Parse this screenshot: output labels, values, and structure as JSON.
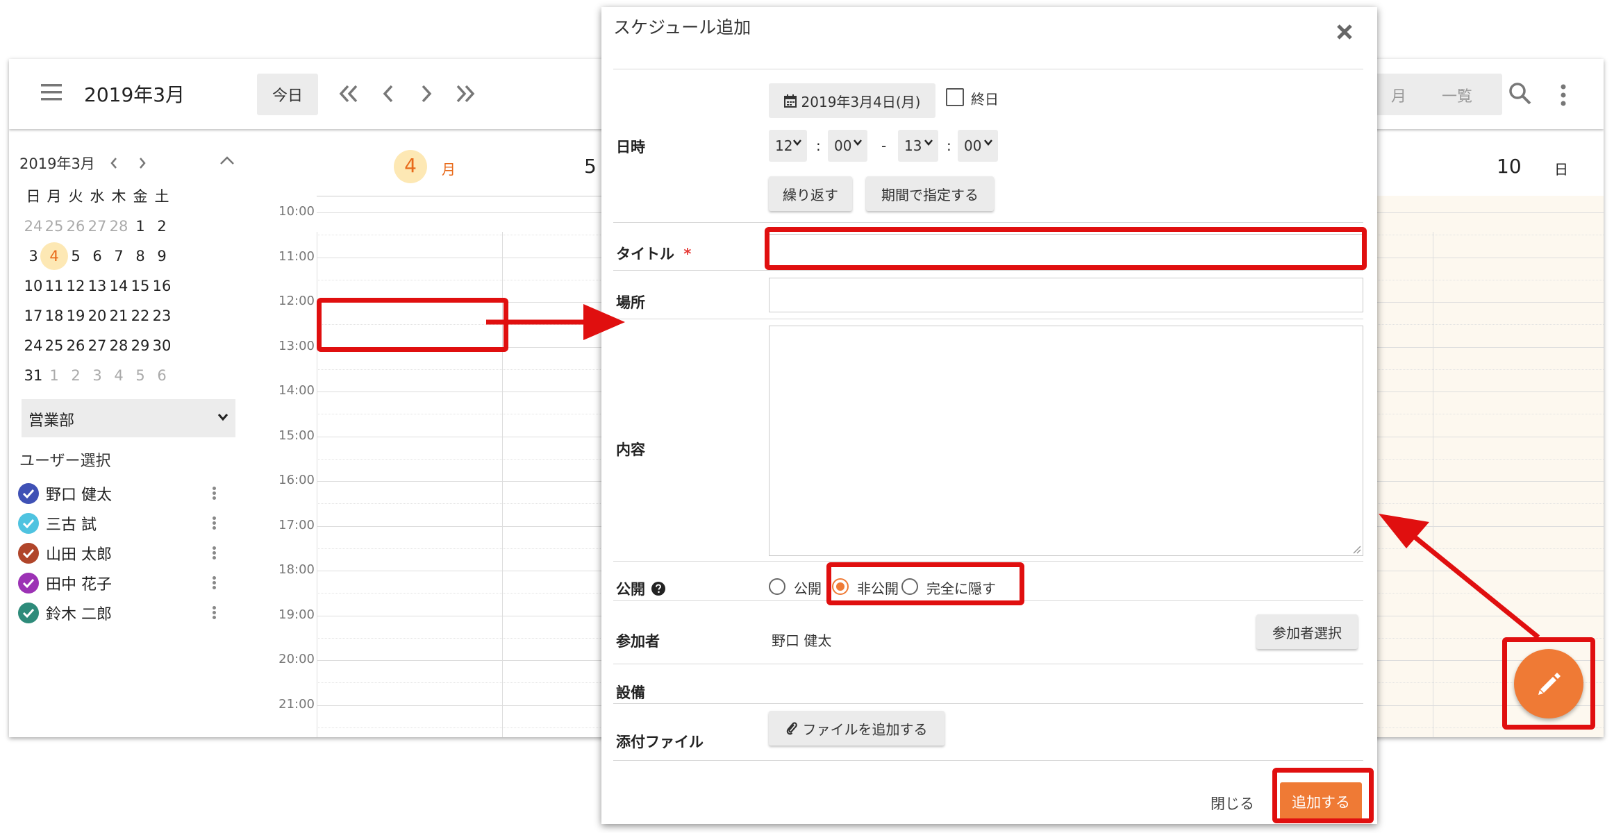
{
  "header": {
    "month_title": "2019年3月",
    "today_button": "今日",
    "view_month": "月",
    "view_list": "一覧"
  },
  "day_headers": {
    "day4_num": "4",
    "day4_weekday": "月",
    "day5_num": "5",
    "day10_num": "10",
    "day10_weekday": "日"
  },
  "mini_calendar": {
    "title": "2019年3月",
    "weekdays": [
      "日",
      "月",
      "火",
      "水",
      "木",
      "金",
      "土"
    ],
    "weeks": [
      [
        "24",
        "25",
        "26",
        "27",
        "28",
        "1",
        "2"
      ],
      [
        "3",
        "4",
        "5",
        "6",
        "7",
        "8",
        "9"
      ],
      [
        "10",
        "11",
        "12",
        "13",
        "14",
        "15",
        "16"
      ],
      [
        "17",
        "18",
        "19",
        "20",
        "21",
        "22",
        "23"
      ],
      [
        "24",
        "25",
        "26",
        "27",
        "28",
        "29",
        "30"
      ],
      [
        "31",
        "1",
        "2",
        "3",
        "4",
        "5",
        "6"
      ]
    ]
  },
  "group_select": {
    "value": "営業部"
  },
  "user_section": {
    "title": "ユーザー選択",
    "users": [
      {
        "name": "野口 健太",
        "color": "#3f51b5"
      },
      {
        "name": "三古 試",
        "color": "#4fc3e0"
      },
      {
        "name": "山田 太郎",
        "color": "#b0452a"
      },
      {
        "name": "田中 花子",
        "color": "#9c32b5"
      },
      {
        "name": "鈴木 二郎",
        "color": "#2e8b7a"
      }
    ]
  },
  "time_labels": [
    "10:00",
    "11:00",
    "12:00",
    "13:00",
    "14:00",
    "15:00",
    "16:00",
    "17:00",
    "18:00",
    "19:00",
    "20:00",
    "21:00"
  ],
  "modal": {
    "title": "スケジュール追加",
    "datetime_label": "日時",
    "date_button": "2019年3月4日(月)",
    "allday_label": "終日",
    "start_hour": "12",
    "start_min": "00",
    "end_hour": "13",
    "end_min": "00",
    "dash": "-",
    "colon": ":",
    "repeat_button": "繰り返す",
    "period_button": "期間で指定する",
    "title_label": "タイトル",
    "required_mark": "*",
    "place_label": "場所",
    "content_label": "内容",
    "public_label": "公開",
    "visibility_options": [
      "公開",
      "非公開",
      "完全に隠す"
    ],
    "visibility_selected": "非公開",
    "participants_label": "参加者",
    "participant_name": "野口 健太",
    "participants_button": "参加者選択",
    "equipment_label": "設備",
    "attachment_label": "添付ファイル",
    "attachment_button": "ファイルを追加する",
    "close_button": "閉じる",
    "add_button": "追加する"
  },
  "colors": {
    "accent_orange": "#ef7a35",
    "annotation_red": "#e00f0f",
    "today_highlight": "#fde8b4",
    "weekend_bg": "#fdf8ef"
  },
  "icons": [
    "menu-icon",
    "double-chevron-left-icon",
    "chevron-left-icon",
    "chevron-right-icon",
    "double-chevron-right-icon",
    "search-icon",
    "kebab-icon",
    "calendar-icon",
    "paperclip-icon",
    "question-icon",
    "close-icon",
    "pencil-icon"
  ]
}
